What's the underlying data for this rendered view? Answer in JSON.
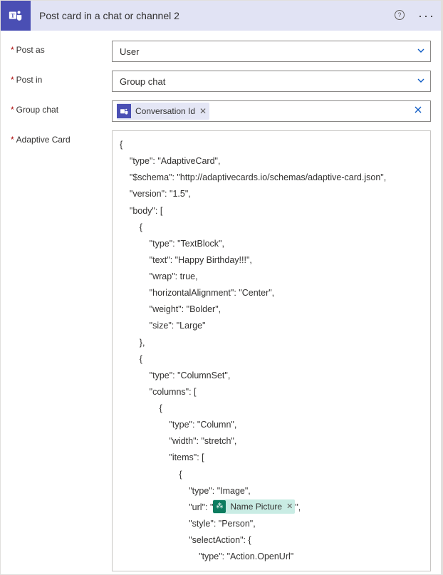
{
  "header": {
    "title": "Post card in a chat or channel 2"
  },
  "fields": {
    "post_as": {
      "label": "Post as",
      "value": "User"
    },
    "post_in": {
      "label": "Post in",
      "value": "Group chat"
    },
    "group_chat": {
      "label": "Group chat",
      "token": "Conversation Id"
    },
    "adaptive_card": {
      "label": "Adaptive Card"
    }
  },
  "code": {
    "l00": "{",
    "l01": "    \"type\": \"AdaptiveCard\",",
    "l02": "    \"$schema\": \"http://adaptivecards.io/schemas/adaptive-card.json\",",
    "l03": "    \"version\": \"1.5\",",
    "l04": "    \"body\": [",
    "l05": "        {",
    "l06": "            \"type\": \"TextBlock\",",
    "l07": "            \"text\": \"Happy Birthday!!!\",",
    "l08": "            \"wrap\": true,",
    "l09": "            \"horizontalAlignment\": \"Center\",",
    "l10": "            \"weight\": \"Bolder\",",
    "l11": "            \"size\": \"Large\"",
    "l12": "        },",
    "l13": "        {",
    "l14": "            \"type\": \"ColumnSet\",",
    "l15": "            \"columns\": [",
    "l16": "                {",
    "l17": "                    \"type\": \"Column\",",
    "l18": "                    \"width\": \"stretch\",",
    "l19": "                    \"items\": [",
    "l20": "                        {",
    "l21": "                            \"type\": \"Image\",",
    "l22_pre": "                            \"url\": \"",
    "l22_token": "Name Picture",
    "l22_post": "\",",
    "l23": "                            \"style\": \"Person\",",
    "l24": "                            \"selectAction\": {",
    "l25": "                                \"type\": \"Action.OpenUrl\""
  }
}
